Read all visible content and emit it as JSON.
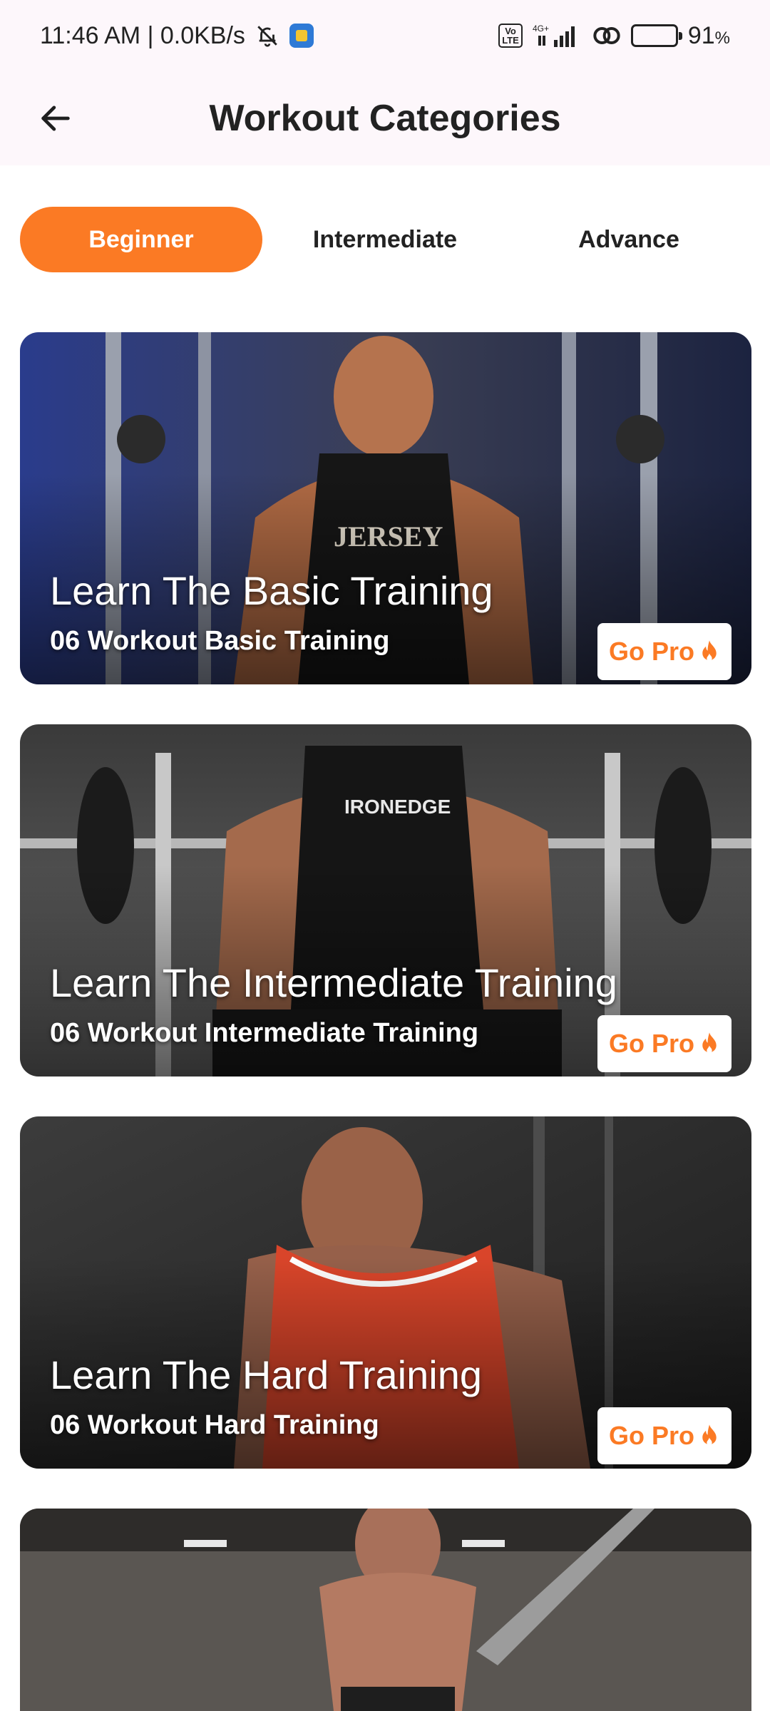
{
  "status_bar": {
    "time_speed": "11:46 AM | 0.0KB/s",
    "network_label": "4G+",
    "volte_label": "Vo\nLTE",
    "battery": "91",
    "battery_unit": "%"
  },
  "header": {
    "title": "Workout Categories"
  },
  "tabs": [
    {
      "label": "Beginner",
      "active": true
    },
    {
      "label": "Intermediate",
      "active": false
    },
    {
      "label": "Advance",
      "active": false
    }
  ],
  "cards": [
    {
      "title": "Learn The Basic Training",
      "subtitle": "06 Workout Basic Training",
      "badge": "Go Pro"
    },
    {
      "title": "Learn The Intermediate Training",
      "subtitle": "06 Workout Intermediate Training",
      "badge": "Go Pro"
    },
    {
      "title": "Learn The Hard Training",
      "subtitle": "06 Workout Hard Training",
      "badge": "Go Pro"
    },
    {
      "title": "",
      "subtitle": "",
      "badge": ""
    }
  ],
  "colors": {
    "accent": "#fb7a24",
    "app_bar_bg": "#fdf7fb"
  },
  "icons": {
    "back": "arrow-left-icon",
    "flame": "flame-icon",
    "mute": "bell-off-icon"
  }
}
